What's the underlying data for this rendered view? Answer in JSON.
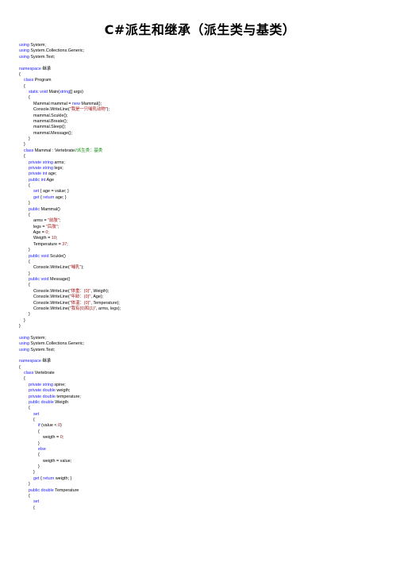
{
  "title": "C#派生和继承（派生类与基类）",
  "colors": {
    "keyword": "#1a1aff",
    "string": "#a31515",
    "comment": "#0a8a0a",
    "text": "#000000"
  },
  "code": {
    "lines": [
      [
        {
          "t": "using",
          "k": "kw"
        },
        {
          "t": " System;"
        }
      ],
      [
        {
          "t": "using",
          "k": "kw"
        },
        {
          "t": " System.Collections.Generic;"
        }
      ],
      [
        {
          "t": "using",
          "k": "kw"
        },
        {
          "t": " System.Text;"
        }
      ],
      [],
      [
        {
          "t": "namespace",
          "k": "kw"
        },
        {
          "t": " 继承"
        }
      ],
      [
        {
          "t": "{"
        }
      ],
      [
        {
          "t": "    "
        },
        {
          "t": "class",
          "k": "kw"
        },
        {
          "t": " Program"
        }
      ],
      [
        {
          "t": "    {"
        }
      ],
      [
        {
          "t": "        "
        },
        {
          "t": "static void",
          "k": "kw"
        },
        {
          "t": " Main("
        },
        {
          "t": "string",
          "k": "kw"
        },
        {
          "t": "[] args)"
        }
      ],
      [
        {
          "t": "        {"
        }
      ],
      [
        {
          "t": "            Mammal mammal = "
        },
        {
          "t": "new",
          "k": "kw"
        },
        {
          "t": " Mammal();"
        }
      ],
      [
        {
          "t": "            Console.WriteLine("
        },
        {
          "t": "\"我是一只哺乳动物\"",
          "k": "str"
        },
        {
          "t": ");"
        }
      ],
      [
        {
          "t": "            mammal.Scukle();"
        }
      ],
      [
        {
          "t": "            mammal.Breate();"
        }
      ],
      [
        {
          "t": "            mammal.Sleep();"
        }
      ],
      [
        {
          "t": "            mammal.Message();"
        }
      ],
      [
        {
          "t": "        }"
        }
      ],
      [
        {
          "t": "    }"
        }
      ],
      [
        {
          "t": "    "
        },
        {
          "t": "class",
          "k": "kw"
        },
        {
          "t": " Mammal : Vertebrate"
        },
        {
          "t": "//派生类：基类",
          "k": "cm"
        }
      ],
      [
        {
          "t": "    {"
        }
      ],
      [
        {
          "t": "        "
        },
        {
          "t": "private string",
          "k": "kw"
        },
        {
          "t": " arms;"
        }
      ],
      [
        {
          "t": "        "
        },
        {
          "t": "private string",
          "k": "kw"
        },
        {
          "t": " legs;"
        }
      ],
      [
        {
          "t": "        "
        },
        {
          "t": "private int",
          "k": "kw"
        },
        {
          "t": " age;"
        }
      ],
      [
        {
          "t": "        "
        },
        {
          "t": "public int",
          "k": "kw"
        },
        {
          "t": " Age"
        }
      ],
      [
        {
          "t": "        {"
        }
      ],
      [
        {
          "t": "            "
        },
        {
          "t": "set",
          "k": "kw"
        },
        {
          "t": " { age = value; }"
        }
      ],
      [
        {
          "t": "            "
        },
        {
          "t": "get",
          "k": "kw"
        },
        {
          "t": " { "
        },
        {
          "t": "return",
          "k": "kw"
        },
        {
          "t": " age; }"
        }
      ],
      [
        {
          "t": "        }"
        }
      ],
      [
        {
          "t": "        "
        },
        {
          "t": "public",
          "k": "kw"
        },
        {
          "t": " Mammal()"
        }
      ],
      [
        {
          "t": "        {"
        }
      ],
      [
        {
          "t": "            arms = "
        },
        {
          "t": "\"前肢\"",
          "k": "str"
        },
        {
          "t": ";"
        }
      ],
      [
        {
          "t": "            legs = "
        },
        {
          "t": "\"后肢\"",
          "k": "str"
        },
        {
          "t": ";"
        }
      ],
      [
        {
          "t": "            Age = "
        },
        {
          "t": "0",
          "k": "num"
        },
        {
          "t": ";"
        }
      ],
      [
        {
          "t": "            Weigth = "
        },
        {
          "t": "10",
          "k": "num"
        },
        {
          "t": ";"
        }
      ],
      [
        {
          "t": "            Temperature = "
        },
        {
          "t": "37",
          "k": "num"
        },
        {
          "t": ";"
        }
      ],
      [
        {
          "t": "        }"
        }
      ],
      [
        {
          "t": "        "
        },
        {
          "t": "public void",
          "k": "kw"
        },
        {
          "t": " Scukle()"
        }
      ],
      [
        {
          "t": "        {"
        }
      ],
      [
        {
          "t": "            Console.WriteLine("
        },
        {
          "t": "\"哺乳\"",
          "k": "str"
        },
        {
          "t": ");"
        }
      ],
      [
        {
          "t": "        }"
        }
      ],
      [
        {
          "t": "        "
        },
        {
          "t": "public void",
          "k": "kw"
        },
        {
          "t": " Message()"
        }
      ],
      [
        {
          "t": "        {"
        }
      ],
      [
        {
          "t": "            Console.WriteLine("
        },
        {
          "t": "\"体重：{0}\"",
          "k": "str"
        },
        {
          "t": ", Weigth);"
        }
      ],
      [
        {
          "t": "            Console.WriteLine("
        },
        {
          "t": "\"年龄：{0}\"",
          "k": "str"
        },
        {
          "t": ", Age);"
        }
      ],
      [
        {
          "t": "            Console.WriteLine("
        },
        {
          "t": "\"体温：{0}\"",
          "k": "str"
        },
        {
          "t": ", Temperature);"
        }
      ],
      [
        {
          "t": "            Console.WriteLine("
        },
        {
          "t": "\"我有{0}和{1}\"",
          "k": "str"
        },
        {
          "t": ", arms, legs);"
        }
      ],
      [
        {
          "t": "        }"
        }
      ],
      [
        {
          "t": "    }"
        }
      ],
      [
        {
          "t": "}"
        }
      ],
      [],
      [
        {
          "t": "using",
          "k": "kw"
        },
        {
          "t": " System;"
        }
      ],
      [
        {
          "t": "using",
          "k": "kw"
        },
        {
          "t": " System.Collections.Generic;"
        }
      ],
      [
        {
          "t": "using",
          "k": "kw"
        },
        {
          "t": " System.Text;"
        }
      ],
      [],
      [
        {
          "t": "namespace",
          "k": "kw"
        },
        {
          "t": " 继承"
        }
      ],
      [
        {
          "t": "{"
        }
      ],
      [
        {
          "t": "    "
        },
        {
          "t": "class",
          "k": "kw"
        },
        {
          "t": " Vertebrate"
        }
      ],
      [
        {
          "t": "    {"
        }
      ],
      [
        {
          "t": "        "
        },
        {
          "t": "private string",
          "k": "kw"
        },
        {
          "t": " spine;"
        }
      ],
      [
        {
          "t": "        "
        },
        {
          "t": "private double",
          "k": "kw"
        },
        {
          "t": " weigth;"
        }
      ],
      [
        {
          "t": "        "
        },
        {
          "t": "private double",
          "k": "kw"
        },
        {
          "t": " temperature;"
        }
      ],
      [
        {
          "t": "        "
        },
        {
          "t": "public double",
          "k": "kw"
        },
        {
          "t": " Weigth"
        }
      ],
      [
        {
          "t": "        {"
        }
      ],
      [
        {
          "t": "            "
        },
        {
          "t": "set",
          "k": "kw"
        }
      ],
      [
        {
          "t": "            {"
        }
      ],
      [
        {
          "t": "                "
        },
        {
          "t": "if",
          "k": "kw"
        },
        {
          "t": " (value < "
        },
        {
          "t": "0",
          "k": "num"
        },
        {
          "t": ")"
        }
      ],
      [
        {
          "t": "                {"
        }
      ],
      [
        {
          "t": "                    weigth = "
        },
        {
          "t": "0",
          "k": "num"
        },
        {
          "t": ";"
        }
      ],
      [
        {
          "t": "                }"
        }
      ],
      [
        {
          "t": "                "
        },
        {
          "t": "else",
          "k": "kw"
        }
      ],
      [
        {
          "t": "                {"
        }
      ],
      [
        {
          "t": "                    weigth = value;"
        }
      ],
      [
        {
          "t": "                }"
        }
      ],
      [
        {
          "t": "            }"
        }
      ],
      [
        {
          "t": "            "
        },
        {
          "t": "get",
          "k": "kw"
        },
        {
          "t": " { "
        },
        {
          "t": "return",
          "k": "kw"
        },
        {
          "t": " weigth; }"
        }
      ],
      [
        {
          "t": "        }"
        }
      ],
      [
        {
          "t": "        "
        },
        {
          "t": "public double",
          "k": "kw"
        },
        {
          "t": " Temperature"
        }
      ],
      [
        {
          "t": "        {"
        }
      ],
      [
        {
          "t": "            "
        },
        {
          "t": "set",
          "k": "kw"
        }
      ],
      [
        {
          "t": "            {"
        }
      ]
    ]
  }
}
